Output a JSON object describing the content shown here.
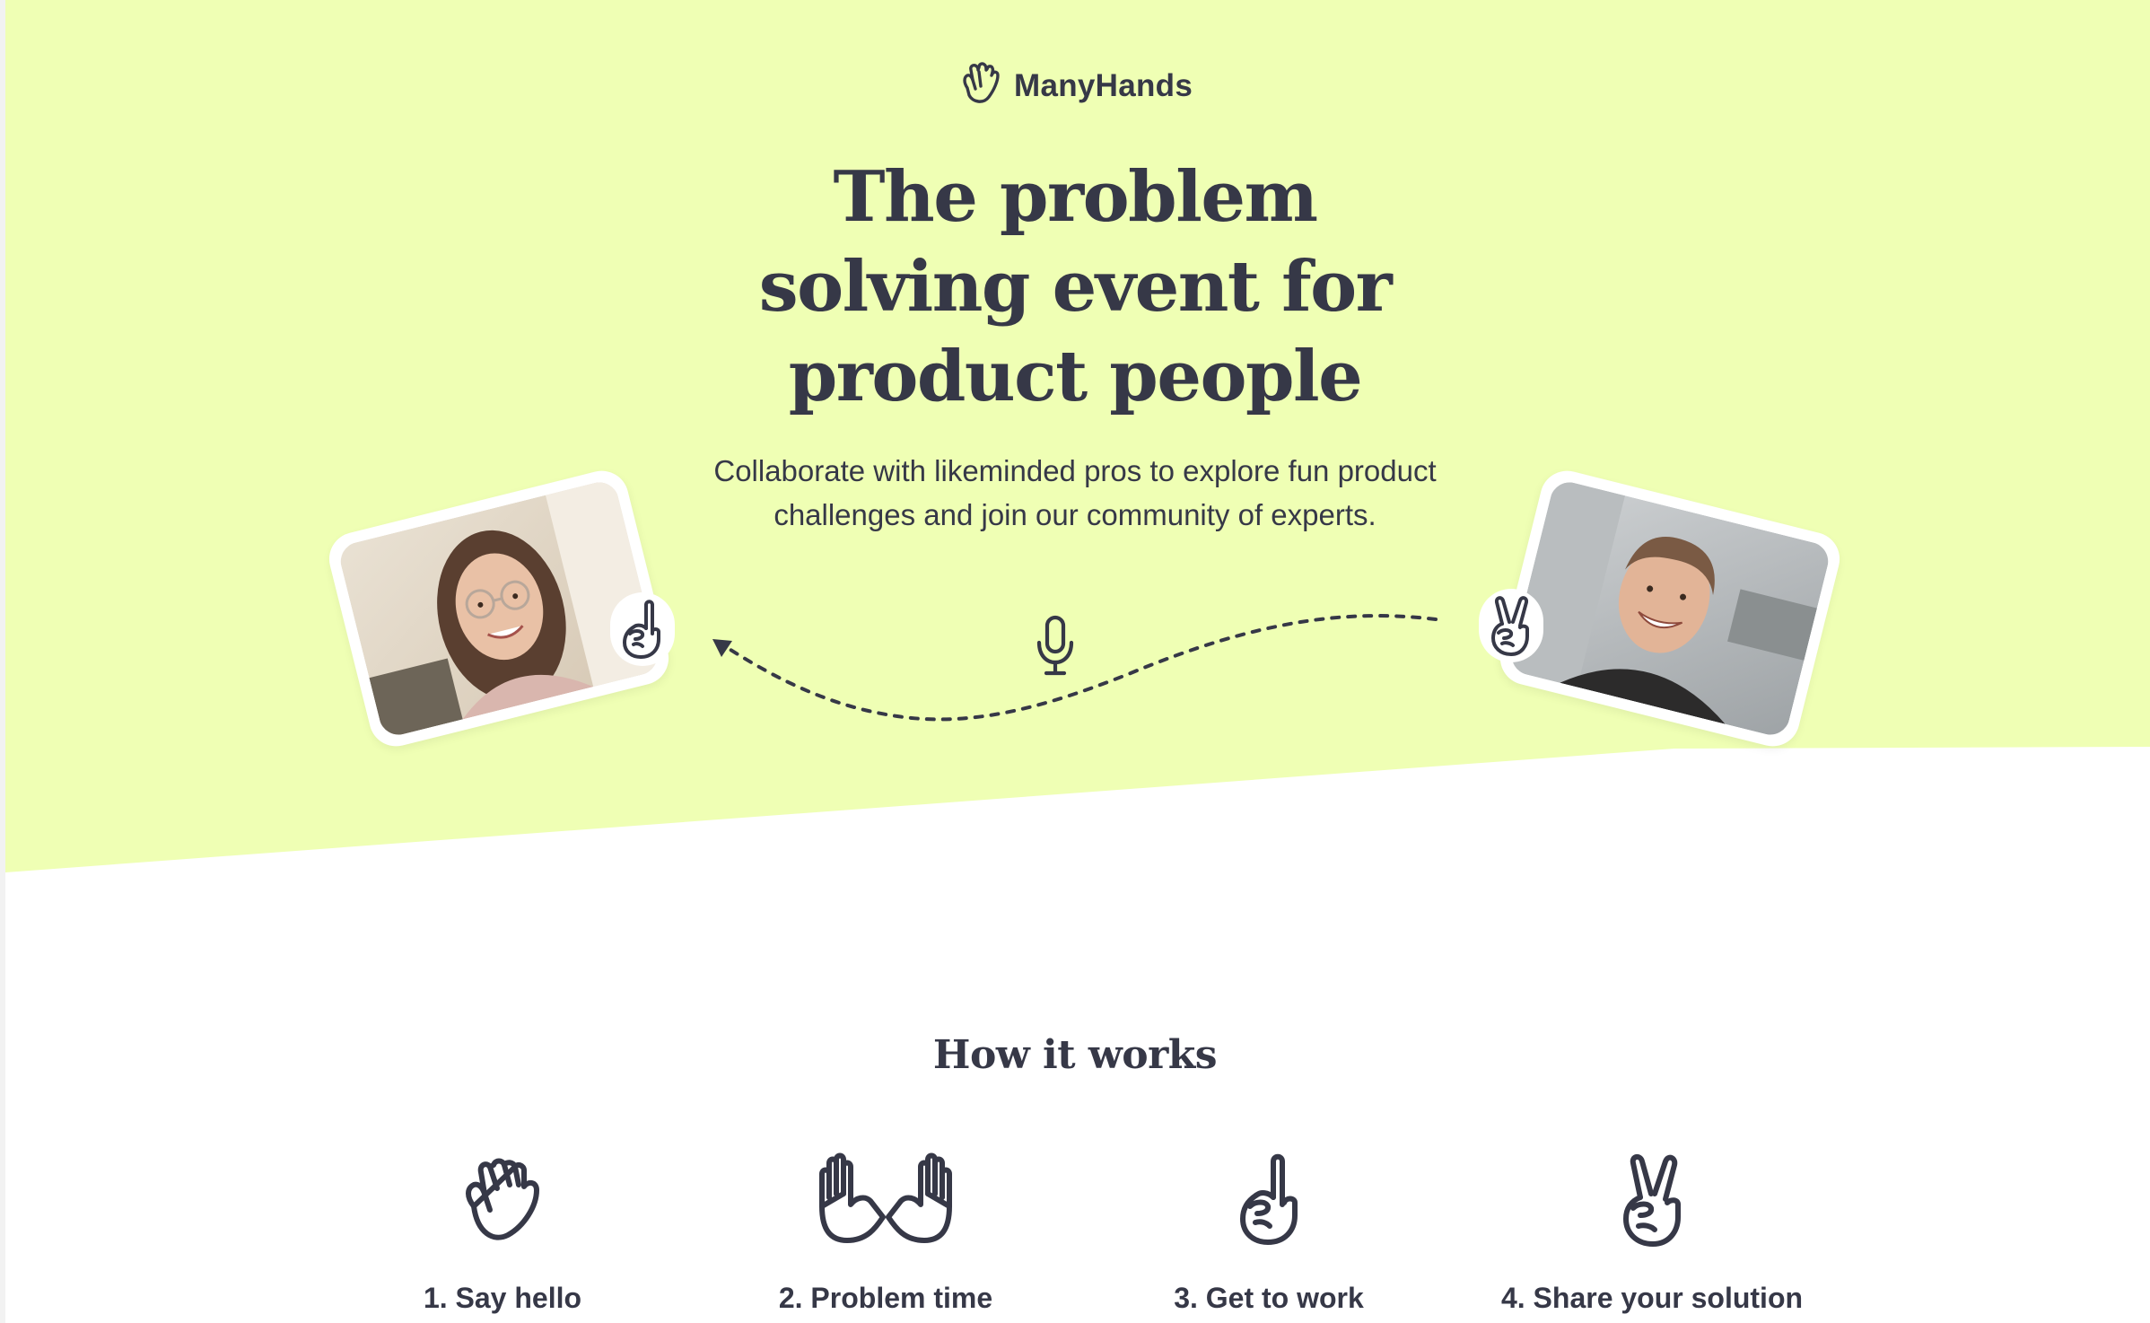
{
  "brand": {
    "name": "ManyHands",
    "logo_icon": "waving-hand-icon"
  },
  "hero": {
    "headline": "The problem solving event for product people",
    "subtitle": "Collaborate with likeminded pros to explore fun product challenges and join our community of experts.",
    "background_color": "#efffb4",
    "left_participant": {
      "photo": "woman-with-glasses-photo",
      "badge_icon": "pointing-finger-icon"
    },
    "right_participant": {
      "photo": "smiling-man-photo",
      "badge_icon": "peace-sign-icon"
    },
    "center_icon": "microphone-icon"
  },
  "how_it_works": {
    "title": "How it works",
    "steps": [
      {
        "label": "1. Say hello",
        "icon": "waving-hand-icon"
      },
      {
        "label": "2. Problem time",
        "icon": "raised-hands-icon"
      },
      {
        "label": "3. Get to work",
        "icon": "pointing-finger-icon"
      },
      {
        "label": "4. Share your solution",
        "icon": "peace-sign-icon"
      }
    ]
  },
  "colors": {
    "text": "#363847",
    "accent": "#efffb4",
    "background": "#ffffff"
  }
}
